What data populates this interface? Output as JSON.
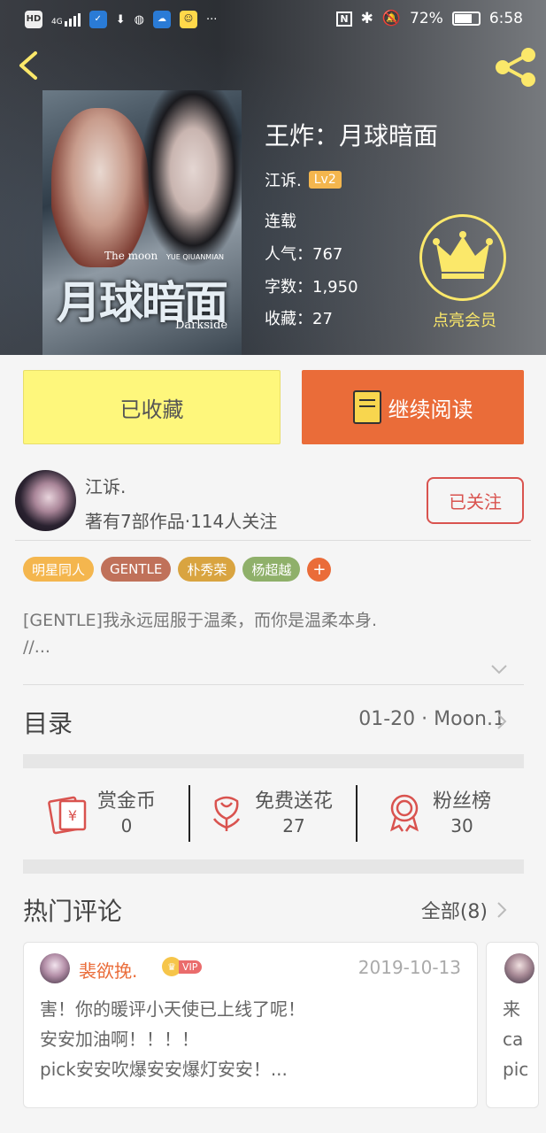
{
  "status_bar": {
    "left_labels": [
      "HD",
      "4G"
    ],
    "more": "···",
    "battery": "72%",
    "battery_level": 0.72,
    "time": "6:58"
  },
  "book": {
    "title": "王炸：月球暗面",
    "author": "江诉.",
    "level": "Lv2",
    "status": "连载",
    "popularity": "人气：767",
    "word_count": "字数：1,950",
    "favorites": "收藏：27",
    "cover_text": {
      "main": "月球暗面",
      "top": "The moon",
      "top_small": "YUE QIUANMIAN",
      "bottom": "Darkside"
    }
  },
  "vip": {
    "label": "点亮会员"
  },
  "actions": {
    "favorited_label": "已收藏",
    "read_label": "继续阅读"
  },
  "author_row": {
    "name": "江诉.",
    "stats": "著有7部作品·114人关注",
    "follow_label": "已关注"
  },
  "tags": [
    {
      "label": "明星同人",
      "color": "#f4b64e"
    },
    {
      "label": "GENTLE",
      "color": "#c0715a"
    },
    {
      "label": "朴秀荣",
      "color": "#d9a440"
    },
    {
      "label": "杨超越",
      "color": "#8fb06a"
    }
  ],
  "tag_add": "+",
  "description": "[GENTLE]我永远屈服于温柔，而你是温柔本身.\n//...",
  "toc": {
    "title": "目录",
    "latest": "01-20 · Moon.1"
  },
  "stats": [
    {
      "label": "赏金币",
      "value": "0"
    },
    {
      "label": "免费送花",
      "value": "27"
    },
    {
      "label": "粉丝榜",
      "value": "30"
    }
  ],
  "comments": {
    "title": "热门评论",
    "all_label": "全部(8)",
    "items": [
      {
        "user": "裴欲挽.",
        "vip": "VIP",
        "date": "2019-10-13",
        "text": "害！你的暖评小天使已上线了呢！\n安安加油啊！！！！\npick安安吹爆安安爆灯安安！..."
      },
      {
        "text": "来\nca\npic"
      }
    ]
  }
}
